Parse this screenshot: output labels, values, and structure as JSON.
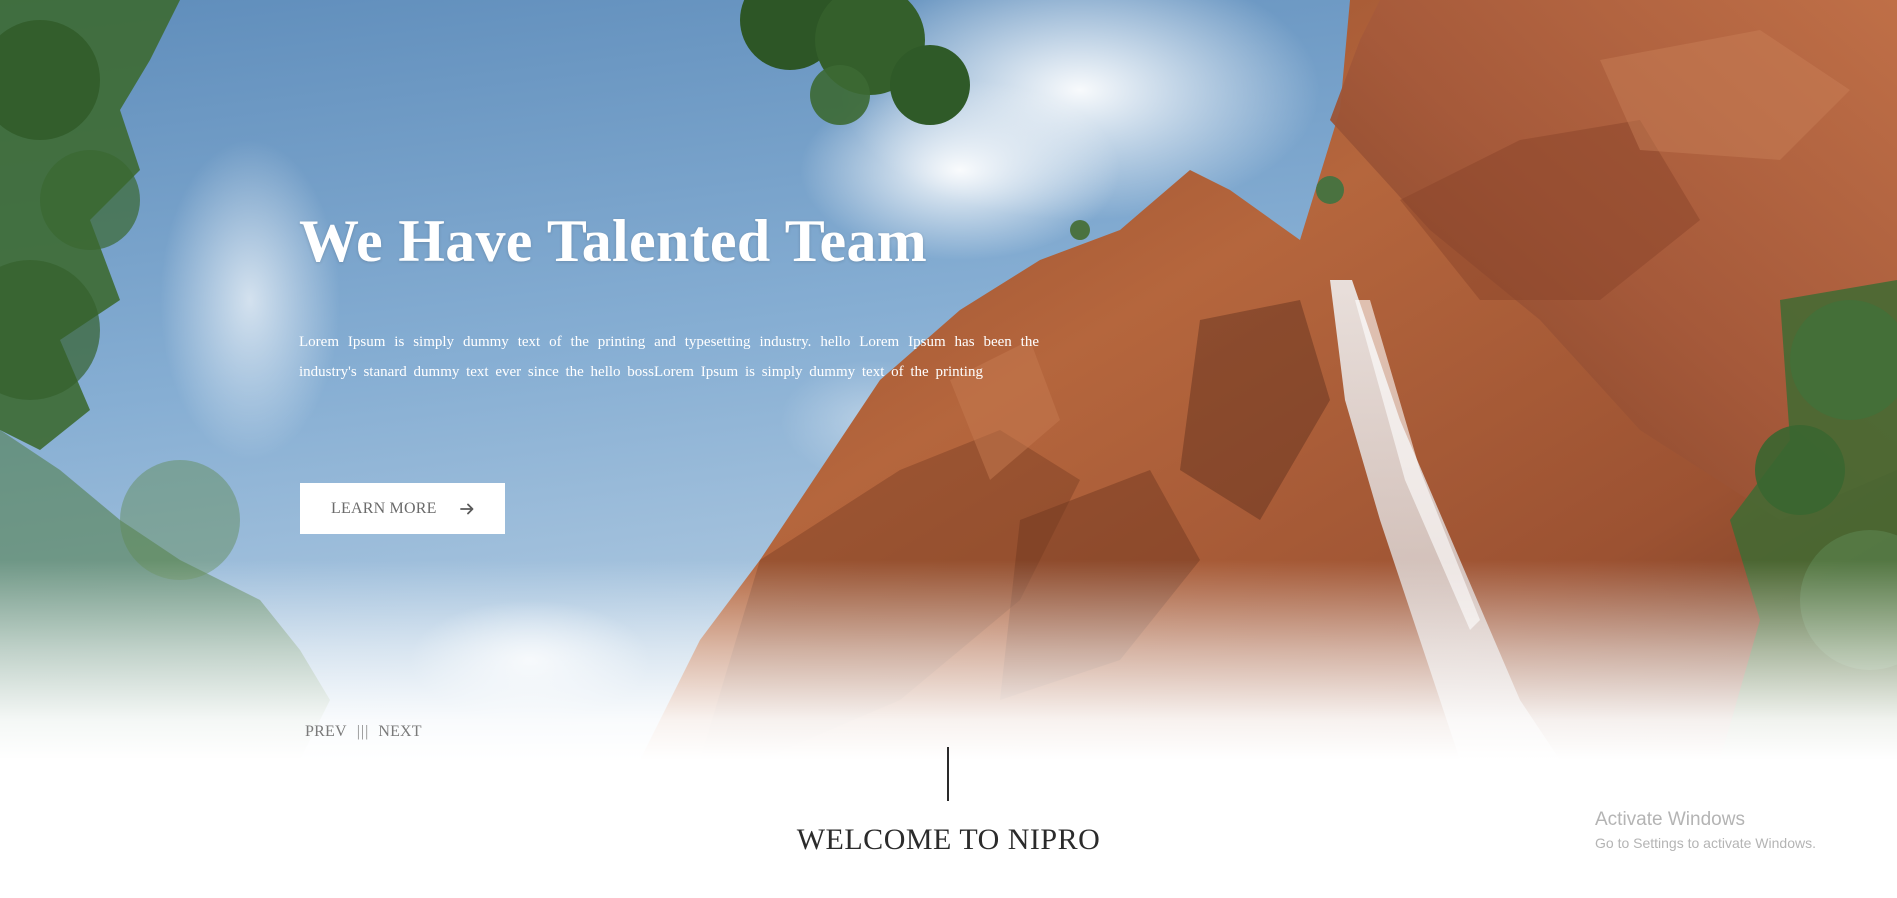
{
  "hero": {
    "title": "We Have Talented Team",
    "text": "Lorem Ipsum is simply dummy text of the printing and typesetting industry. hello Lorem Ipsum has been the industry's stanard dummy text ever since the hello bossLorem Ipsum is simply dummy text of the printing",
    "button_label": "LEARN MORE",
    "button_icon": "arrow-right-icon"
  },
  "slider": {
    "prev_label": "PREV",
    "separator": "|||",
    "next_label": "NEXT"
  },
  "welcome": {
    "title": "WELCOME TO NIPRO"
  },
  "watermark": {
    "title": "Activate Windows",
    "subtitle": "Go to Settings to activate Windows."
  },
  "colors": {
    "sky": "#7aa3c9",
    "cliff": "#a45a35",
    "foliage": "#3f6b33",
    "button_bg": "#ffffff",
    "button_text": "#6b6b6b",
    "heading_text": "#2b2b2b"
  }
}
